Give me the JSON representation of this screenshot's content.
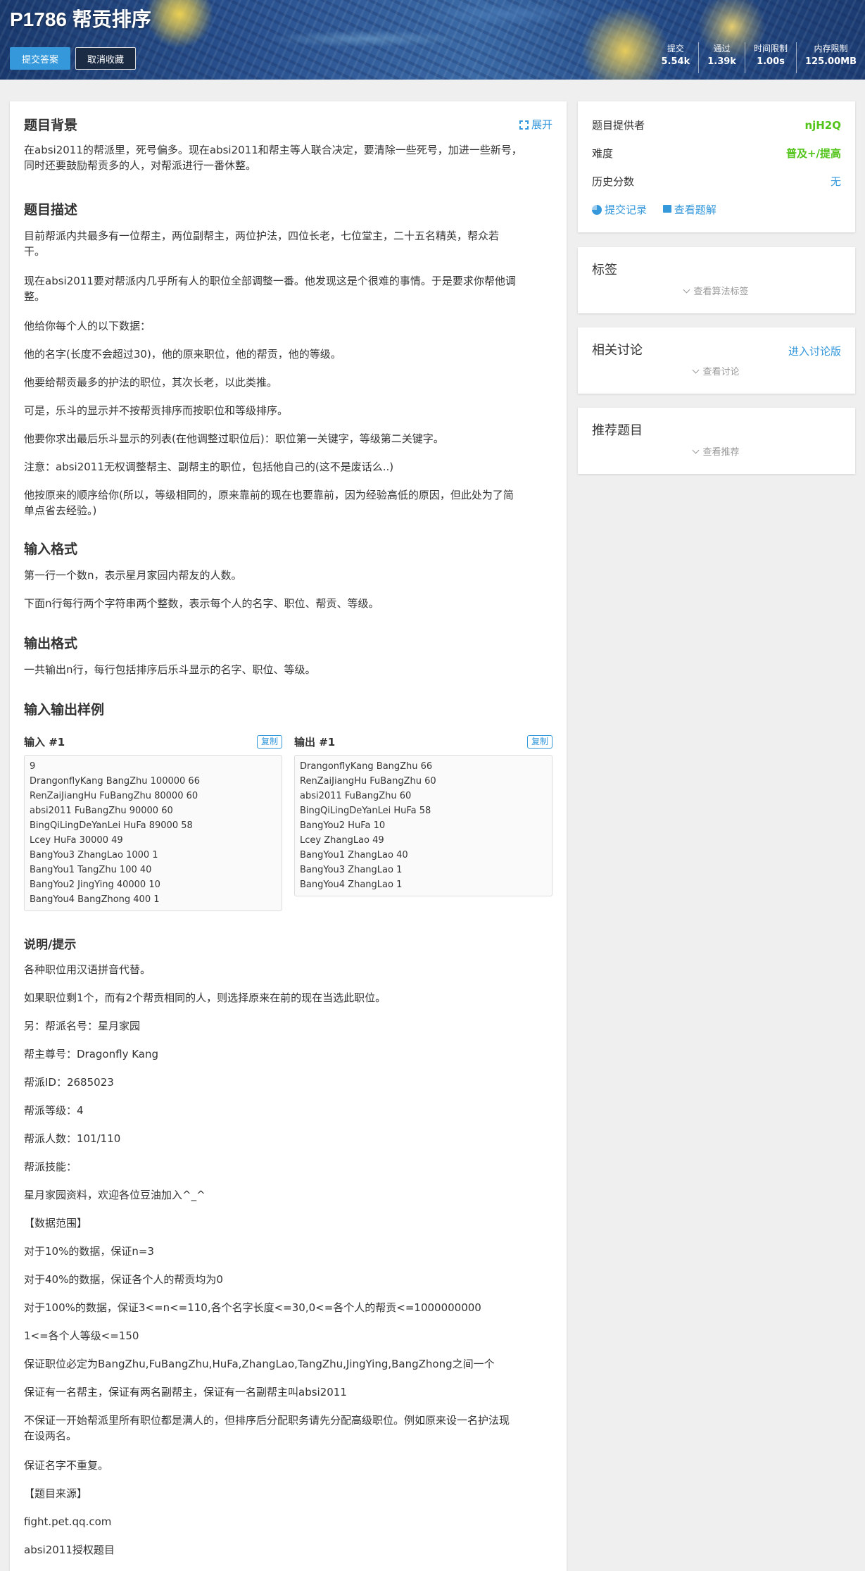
{
  "header": {
    "title": "P1786 帮贡排序",
    "submit_label": "提交答案",
    "unfavorite_label": "取消收藏",
    "stats": [
      {
        "label": "提交",
        "value": "5.54k"
      },
      {
        "label": "通过",
        "value": "1.39k"
      },
      {
        "label": "时间限制",
        "value": "1.00s"
      },
      {
        "label": "内存限制",
        "value": "125.00MB"
      }
    ]
  },
  "main": {
    "expand_label": "展开",
    "background": {
      "title": "题目背景",
      "text": [
        "在absi2011的帮派里，死号偏多。现在absi2011和帮主等人联合决定，要清除一些死号，加进一些新号，",
        "同时还要鼓励帮贡多的人，对帮派进行一番休整。"
      ]
    },
    "description": {
      "title": "题目描述",
      "paras": [
        [
          "目前帮派内共最多有一位帮主，两位副帮主，两位护法，四位长老，七位堂主，二十五名精英，帮众若",
          "干。"
        ],
        [
          "现在absi2011要对帮派内几乎所有人的职位全部调整一番。他发现这是个很难的事情。于是要求你帮他调",
          "整。"
        ],
        [
          "他给你每个人的以下数据："
        ],
        [
          "他的名字(长度不会超过30)，他的原来职位，他的帮贡，他的等级。"
        ],
        [
          "他要给帮贡最多的护法的职位，其次长老，以此类推。"
        ],
        [
          "可是，乐斗的显示并不按帮贡排序而按职位和等级排序。"
        ],
        [
          "他要你求出最后乐斗显示的列表(在他调整过职位后)：职位第一关键字，等级第二关键字。"
        ],
        [
          "注意：absi2011无权调整帮主、副帮主的职位，包括他自己的(这不是废话么..)"
        ],
        [
          "他按原来的顺序给你(所以，等级相同的，原来靠前的现在也要靠前，因为经验高低的原因，但此处为了简",
          "单点省去经验。)"
        ]
      ]
    },
    "input_format": {
      "title": "输入格式",
      "paras": [
        "第一行一个数n，表示星月家园内帮友的人数。",
        "下面n行每行两个字符串两个整数，表示每个人的名字、职位、帮贡、等级。"
      ]
    },
    "output_format": {
      "title": "输出格式",
      "paras": [
        "一共输出n行，每行包括排序后乐斗显示的名字、职位、等级。"
      ]
    },
    "samples": {
      "title": "输入输出样例",
      "copy_label": "复制",
      "input_head": "输入 #1",
      "output_head": "输出 #1",
      "input_lines": [
        "9",
        "DrangonflyKang BangZhu 100000 66",
        "RenZaiJiangHu FuBangZhu 80000 60",
        "absi2011 FuBangZhu 90000 60",
        "BingQiLingDeYanLei HuFa 89000 58",
        "Lcey HuFa 30000 49",
        "BangYou3 ZhangLao 1000 1",
        "BangYou1 TangZhu 100 40",
        "BangYou2 JingYing 40000 10",
        "BangYou4 BangZhong 400 1"
      ],
      "output_lines": [
        "DrangonflyKang BangZhu 66",
        "RenZaiJiangHu FuBangZhu 60",
        "absi2011 FuBangZhu 60",
        "BingQiLingDeYanLei HuFa 58",
        "BangYou2 HuFa 10",
        "Lcey ZhangLao 49",
        "BangYou1 ZhangLao 40",
        "BangYou3 ZhangLao 1",
        "BangYou4 ZhangLao 1"
      ]
    },
    "hint": {
      "title": "说明/提示",
      "paras": [
        [
          "各种职位用汉语拼音代替。"
        ],
        [
          "如果职位剩1个，而有2个帮贡相同的人，则选择原来在前的现在当选此职位。"
        ],
        [
          "另：帮派名号：星月家园"
        ],
        [
          "帮主尊号：Dragonfly Kang"
        ],
        [
          "帮派ID：2685023"
        ],
        [
          "帮派等级：4"
        ],
        [
          "帮派人数：101/110"
        ],
        [
          "帮派技能："
        ],
        [
          "星月家园资料，欢迎各位豆油加入^_^"
        ],
        [
          "【数据范围】"
        ],
        [
          "对于10%的数据，保证n=3"
        ],
        [
          "对于40%的数据，保证各个人的帮贡均为0"
        ],
        [
          "对于100%的数据，保证3<=n<=110,各个名字长度<=30,0<=各个人的帮贡<=1000000000"
        ],
        [
          "1<=各个人等级<=150"
        ],
        [
          "保证职位必定为BangZhu,FuBangZhu,HuFa,ZhangLao,TangZhu,JingYing,BangZhong之间一个"
        ],
        [
          "保证有一名帮主，保证有两名副帮主，保证有一名副帮主叫absi2011"
        ],
        [
          "不保证一开始帮派里所有职位都是满人的，但排序后分配职务请先分配高级职位。例如原来设一名护法现",
          "在设两名。"
        ],
        [
          "保证名字不重复。"
        ],
        [
          "【题目来源】"
        ],
        [
          "fight.pet.qq.com"
        ],
        [
          "absi2011授权题目"
        ]
      ]
    }
  },
  "sidebar": {
    "info": {
      "provider_label": "题目提供者",
      "provider_value": "njH2Q",
      "difficulty_label": "难度",
      "difficulty_value": "普及+/提高",
      "history_label": "历史分数",
      "history_value": "无",
      "records_label": "提交记录",
      "solutions_label": "查看题解"
    },
    "tags": {
      "title": "标签",
      "hint": "查看算法标签"
    },
    "discuss": {
      "title": "相关讨论",
      "link": "进入讨论版",
      "hint": "查看讨论"
    },
    "recommend": {
      "title": "推荐题目",
      "hint": "查看推荐"
    },
    "colors": {
      "accent": "#3498db",
      "green": "#52c41a",
      "dark_button": "#1c2b44"
    }
  }
}
